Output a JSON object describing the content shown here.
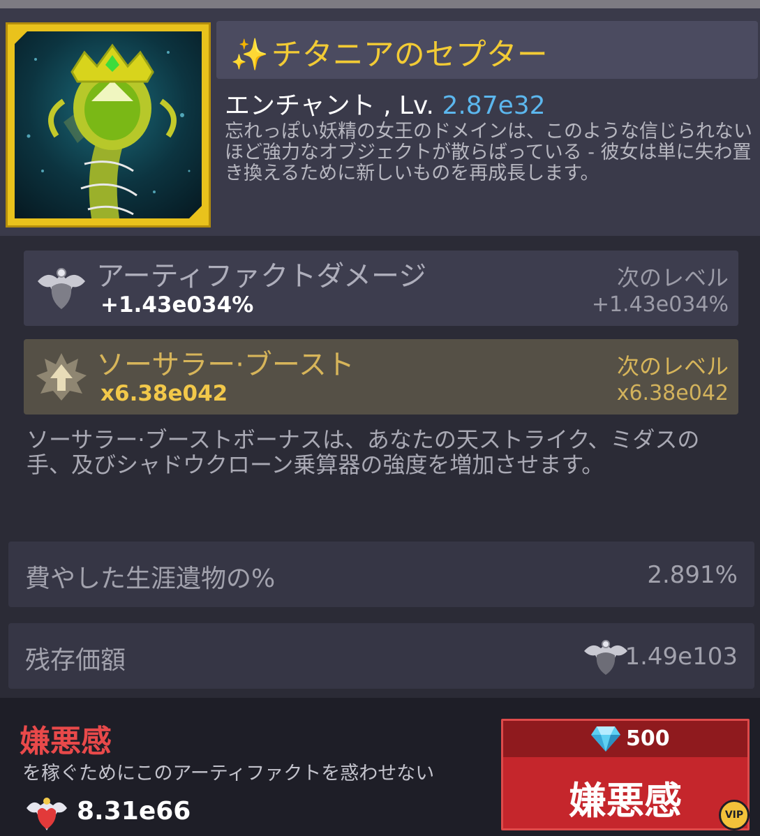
{
  "artifact": {
    "sparkle_icon": "sparkle-icon",
    "name": "チタニアのセプター",
    "level_prefix": "エンチャント , Lv. ",
    "level_value": "2.87e32",
    "description": "忘れっぽい妖精の女王のドメインは、このような信じられないほど強力なオブジェクトが散らばっている - 彼女は単に失わ置き換えるために新しいものを再成長します。"
  },
  "stats": {
    "damage": {
      "icon": "artifact-damage-icon",
      "name": "アーティファクトダメージ",
      "value": "+1.43e034%",
      "next_label": "次のレベル",
      "next_value": "+1.43e034%"
    },
    "boost": {
      "icon": "sorcerer-boost-icon",
      "name": "ソーサラー·ブースト",
      "value": "x6.38e042",
      "next_label": "次のレベル",
      "next_value": "x6.38e042",
      "description": "ソーサラー·ブーストボーナスは、あなたの天ストライク、ミダスの手、及びシャドウクローン乗算器の強度を増加させます。"
    }
  },
  "info": {
    "spent_label": "費やした生涯遺物の%",
    "spent_value": "2.891%",
    "remaining_label": "残存価額",
    "remaining_value": "1.49e103",
    "remaining_icon": "relic-icon"
  },
  "footer": {
    "title": "嫌悪感",
    "subtitle": "を稼ぐためにこのアーティファクトを惑わせない",
    "reward_icon": "dislike-heart-icon",
    "reward_amount": "8.31e66"
  },
  "button": {
    "gem_icon": "diamond-icon",
    "cost": "500",
    "label": "嫌悪感",
    "badge": "VIP"
  },
  "colors": {
    "gold": "#f2cb35",
    "level_blue": "#5cb7ee",
    "red_button": "#c5262c",
    "footer_title": "#e8494a"
  }
}
